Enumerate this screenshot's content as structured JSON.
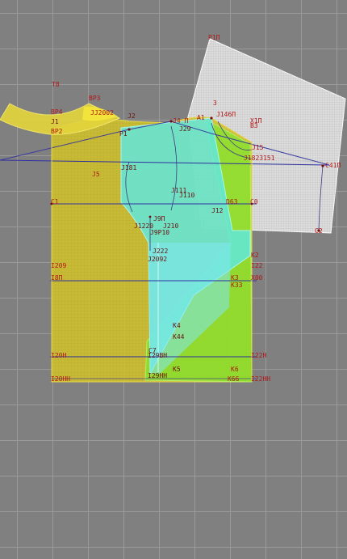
{
  "labels": {
    "l0": "T8",
    "l1": "P1П",
    "l2": "BP3",
    "l3": "JJ2002",
    "l4": "BP4",
    "l5": "J1",
    "l6": "BP2",
    "l7": "J2",
    "l8": "P1",
    "l9": "3",
    "l10": "J146П",
    "l11": "X1П",
    "l12": "J4 П",
    "l13": "J29",
    "l14": "A1",
    "l15": "B3",
    "l16": "J15",
    "l17": "J1823151",
    "l18": "J5",
    "l19": "J181",
    "l20": "C41П",
    "l21": "J111",
    "l22": "J110",
    "l23": "C1",
    "l24": "D63",
    "l25": "C0",
    "l26": "J12",
    "l27": "J9П",
    "l28": "J1220",
    "l29": "J210",
    "l30": "J9P10",
    "l31": "C2",
    "l32": "J222",
    "l33": "J2092",
    "l34": "K2",
    "l35": "I209",
    "l36": "I22",
    "l37": "I8П",
    "l38": "K3",
    "l39": "X00",
    "l40": "K33",
    "l41": "K4",
    "l42": "K44",
    "l43": "C7",
    "l44": "I20H",
    "l45": "I29BH",
    "l46": "I22H",
    "l47": "K5",
    "l48": "K6",
    "l49": "I20HH",
    "l50": "I29HH",
    "l51": "K66",
    "l52": "I22HH"
  },
  "colors": {
    "canvas": "#808080",
    "grid": "#9a9a9a",
    "bodice_fill": "#d2c22a",
    "lining_fill": "#5fe8e2",
    "facing_fill": "#7ee62e",
    "sleeve_fill": "#e4e4e4",
    "construction_line": "#3030a0",
    "label_text": "#b01818"
  }
}
